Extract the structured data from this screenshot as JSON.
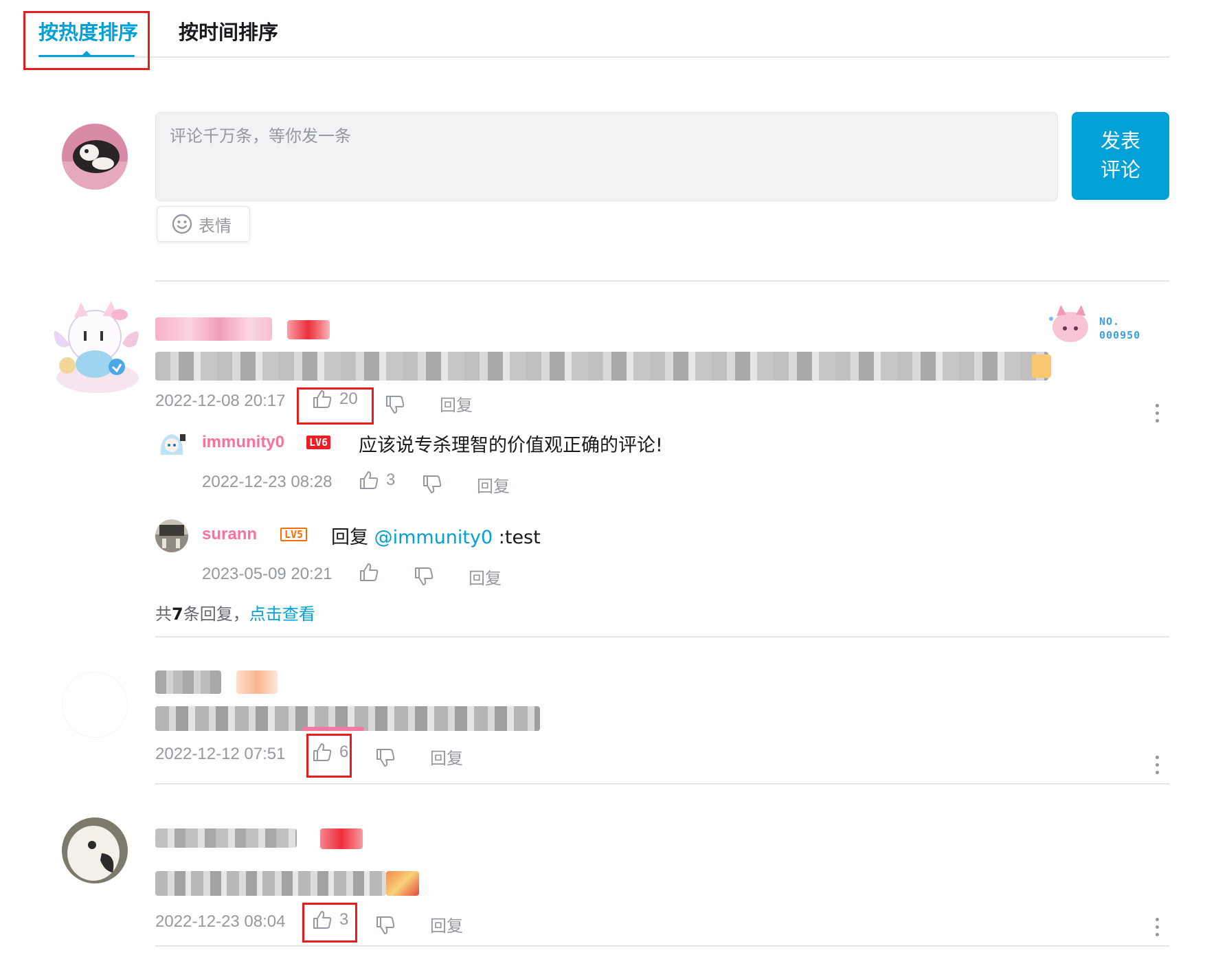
{
  "tabs": [
    {
      "label": "按热度排序",
      "active": true
    },
    {
      "label": "按时间排序",
      "active": false
    }
  ],
  "composer": {
    "placeholder": "评论千万条，等你发一条",
    "post_label_line1": "发表",
    "post_label_line2": "评论",
    "emoji_label": "表情"
  },
  "comments": [
    {
      "time": "2022-12-08 20:17",
      "likes": "20",
      "reply_label": "回复",
      "fan_badge": {
        "line1": "NO.",
        "line2": "000950"
      },
      "replies": [
        {
          "user": "immunity0",
          "level": "LV6",
          "text": "应该说专杀理智的价值观正确的评论!",
          "time": "2022-12-23 08:28",
          "likes": "3",
          "reply_label": "回复"
        },
        {
          "user": "surann",
          "level": "LV5",
          "prefix": "回复",
          "mention": "@immunity0",
          "text": ":test",
          "time": "2023-05-09 20:21",
          "likes": "",
          "reply_label": "回复"
        }
      ],
      "more_replies": {
        "prefix": "共",
        "count": "7",
        "suffix": "条回复，",
        "link": "点击查看"
      }
    },
    {
      "time": "2022-12-12 07:51",
      "likes": "6",
      "reply_label": "回复"
    },
    {
      "time": "2022-12-23 08:04",
      "likes": "3",
      "reply_label": "回复"
    }
  ],
  "colors": {
    "accent": "#00a1d6",
    "username": "#fb7299",
    "highlight": "#e81c1c",
    "muted": "#9499a0"
  }
}
